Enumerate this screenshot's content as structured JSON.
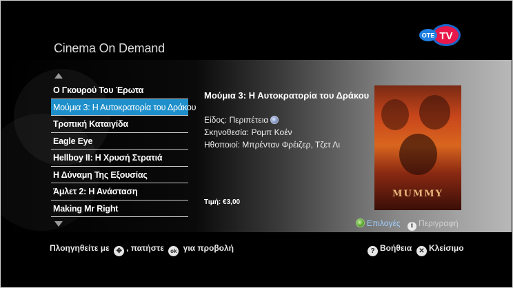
{
  "app": {
    "title": "Cinema On Demand",
    "logo_text_a": "OTE",
    "logo_text_b": "TV"
  },
  "list": {
    "items": [
      {
        "label": "Ο Γκουρού Του Έρωτα"
      },
      {
        "label": "Μούμια 3: Η Αυτοκρατορία του Δράκου"
      },
      {
        "label": "Τροπική Καταιγίδα"
      },
      {
        "label": "Eagle Eye"
      },
      {
        "label": "Hellboy II: Η Χρυσή Στρατιά"
      },
      {
        "label": "Η Δύναμη Της Εξουσίας"
      },
      {
        "label": "Άμλετ 2: Η Ανάσταση"
      },
      {
        "label": "Making Mr Right"
      }
    ],
    "selected_index": 1
  },
  "details": {
    "title": "Μούμια 3: Η Αυτοκρατορία του Δράκου",
    "genre": "Είδος: Περιπέτεια",
    "director": "Σκηνοθεσία: Ρομπ Κοέν",
    "actors": "Ηθοποιοί: Μπρένταν Φρέιζερ, Τζετ Λι",
    "price": "Τιμή: €3,00",
    "poster_text": "MUMMY"
  },
  "options": {
    "options_label": "Επιλογές",
    "description_label": "Περιγραφή"
  },
  "footer": {
    "nav_prefix": "Πλοηγηθείτε με",
    "nav_middle": ", πατήστε",
    "nav_suffix": "για προβολή",
    "ok_glyph": "ok",
    "help_label": "Βοήθεια",
    "help_glyph": "?",
    "close_label": "Κλείσιμο",
    "close_glyph": "✕",
    "info_glyph": "i"
  },
  "colors": {
    "selection": "#1e8fcb",
    "options_text": "#9fd0ff"
  }
}
